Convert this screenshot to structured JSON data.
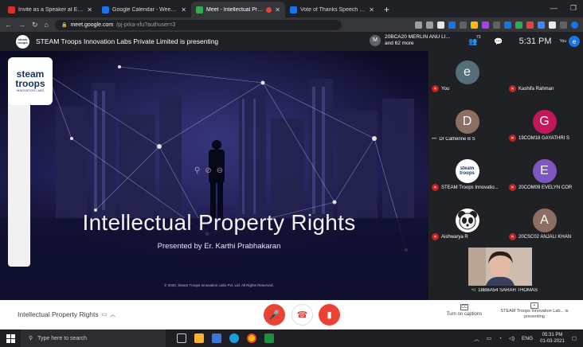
{
  "browser": {
    "tabs": [
      {
        "title": "Invite as a Speaker at Entreprene",
        "favicon_color": "#d93025",
        "active": false
      },
      {
        "title": "Google Calendar - Week of Febr",
        "favicon_color": "#1a73e8",
        "active": false
      },
      {
        "title": "Meet - Intellectual Property",
        "favicon_color": "#34a853",
        "active": true
      },
      {
        "title": "Vote of Thanks Speech For Gues",
        "favicon_color": "#1a73e8",
        "active": false
      }
    ],
    "new_tab": "+",
    "address": {
      "host": "meet.google.com",
      "path": "/pj-prka-xfu?authuser=3"
    }
  },
  "meet": {
    "banner": "STEAM Troops Innovation Labs Private Limited is presenting",
    "presenter_chip": {
      "initial": "M",
      "name": "20BCA20 MERLIN ANU LI...",
      "others": "and 62 more"
    },
    "participant_count": "73",
    "clock": "5:31 PM",
    "you_initial": "e",
    "you_label": "You"
  },
  "slide": {
    "logo": {
      "line1": "steam",
      "line2": "troops",
      "line3": "INNOVATION LABS"
    },
    "title": "Intellectual Property Rights",
    "subtitle": "Presented by Er. Karthi Prabhakaran",
    "footer": "© 2020, Steam Troops Innovation Labs Pvt. Ltd. All Rights Reserved."
  },
  "participants": [
    {
      "name": "You",
      "initial": "e",
      "color": "#546e7a",
      "muted": true
    },
    {
      "name": "Kashifa Rahman",
      "initial": "",
      "color": "#202124",
      "muted": true
    },
    {
      "name": "Dr Catherine B S",
      "initial": "D",
      "color": "#8d6e63",
      "muted": false
    },
    {
      "name": "19COM18 GAYATHRI S",
      "initial": "G",
      "color": "#c2185b",
      "muted": true
    },
    {
      "name": "STEAM Troops Innovatio...",
      "initial": "",
      "color": "#ffffff",
      "muted": true
    },
    {
      "name": "20COM09 EVELYN COR",
      "initial": "E",
      "color": "#7e57c2",
      "muted": true
    },
    {
      "name": "Aishwarya R",
      "initial": "",
      "color": "#ffffff",
      "muted": true
    },
    {
      "name": "20CSC02 ANJALI KHAN",
      "initial": "A",
      "color": "#8d6e63",
      "muted": true
    },
    {
      "name": "18BBA54 SARAH THOMAS",
      "initial": "",
      "color": "#c9b6a8",
      "muted": false
    }
  ],
  "bottombar": {
    "meeting_title": "Intellectual Property Rights",
    "captions_label": "Turn on captions",
    "presenting_label": "STEAM Troops Innovation Lab... is presenting"
  },
  "taskbar": {
    "search_placeholder": "Type here to search",
    "language": "ENG",
    "time": "05:31 PM",
    "date": "01-03-2021"
  }
}
